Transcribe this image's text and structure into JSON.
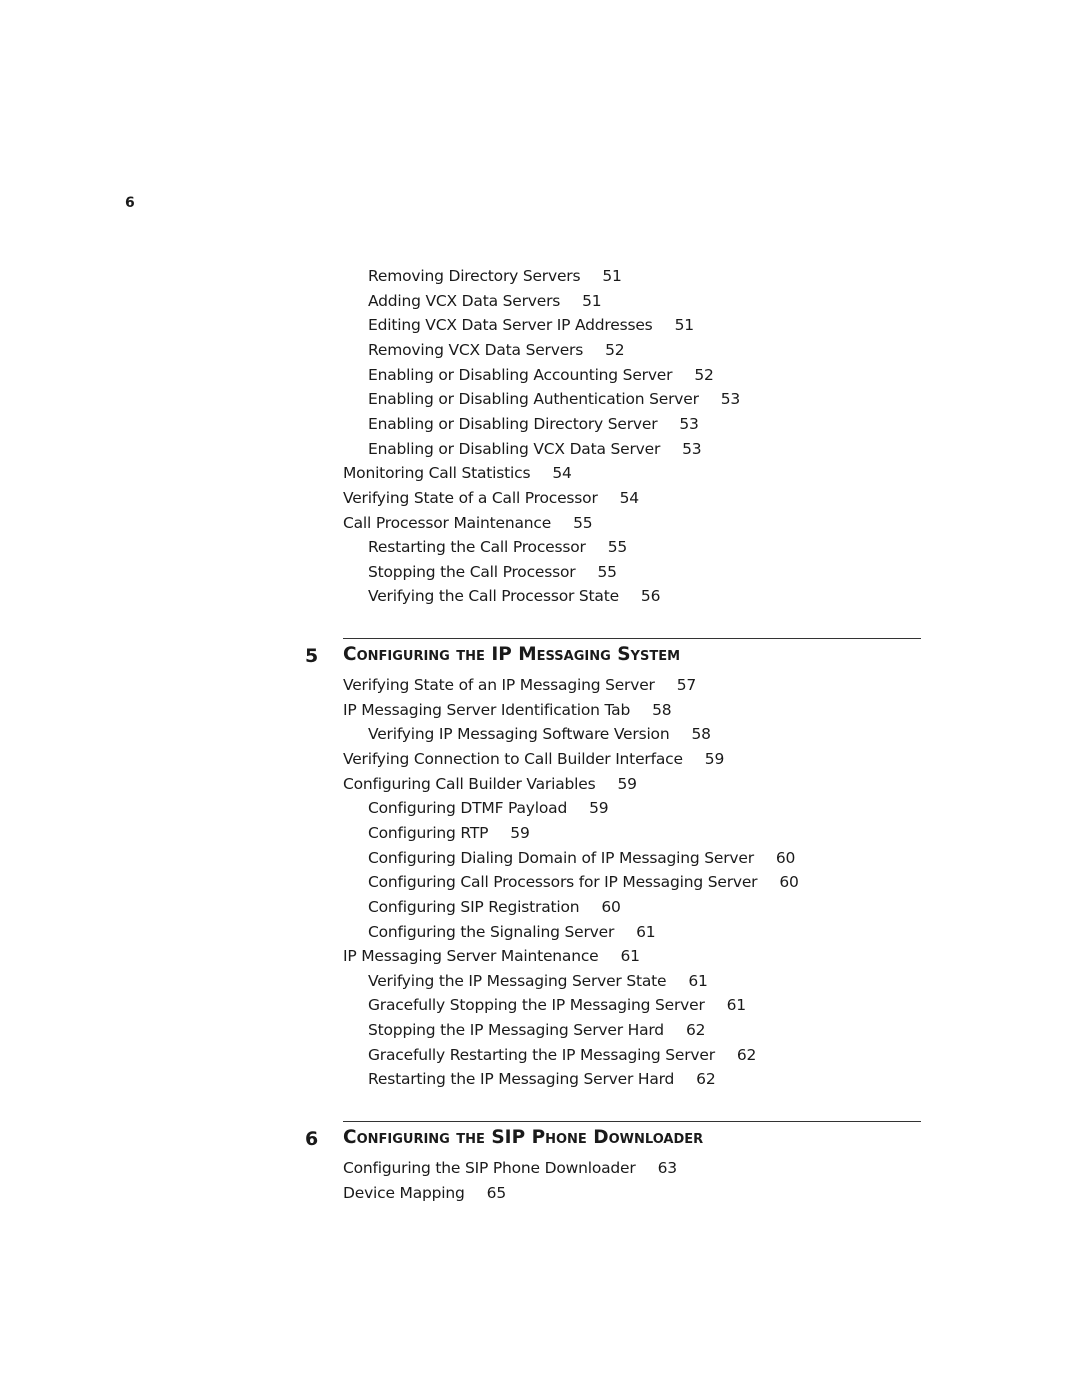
{
  "page_number": "6",
  "pre_entries": [
    {
      "level": 2,
      "title": "Removing Directory Servers",
      "page": "51"
    },
    {
      "level": 2,
      "title": "Adding VCX Data Servers",
      "page": "51"
    },
    {
      "level": 2,
      "title": "Editing VCX Data Server IP Addresses",
      "page": "51"
    },
    {
      "level": 2,
      "title": "Removing VCX Data Servers",
      "page": "52"
    },
    {
      "level": 2,
      "title": "Enabling or Disabling Accounting Server",
      "page": "52"
    },
    {
      "level": 2,
      "title": "Enabling or Disabling Authentication Server",
      "page": "53"
    },
    {
      "level": 2,
      "title": "Enabling or Disabling Directory Server",
      "page": "53"
    },
    {
      "level": 2,
      "title": "Enabling or Disabling VCX Data Server",
      "page": "53"
    },
    {
      "level": 1,
      "title": "Monitoring Call Statistics",
      "page": "54"
    },
    {
      "level": 1,
      "title": "Verifying State of a Call Processor",
      "page": "54"
    },
    {
      "level": 1,
      "title": "Call Processor Maintenance",
      "page": "55"
    },
    {
      "level": 2,
      "title": "Restarting the Call Processor",
      "page": "55"
    },
    {
      "level": 2,
      "title": "Stopping the Call Processor",
      "page": "55"
    },
    {
      "level": 2,
      "title": "Verifying the Call Processor State",
      "page": "56"
    }
  ],
  "chapters": [
    {
      "number": "5",
      "title": "Configuring the IP Messaging System",
      "entries": [
        {
          "level": 1,
          "title": "Verifying State of an IP Messaging Server",
          "page": "57"
        },
        {
          "level": 1,
          "title": "IP Messaging Server Identification Tab",
          "page": "58"
        },
        {
          "level": 2,
          "title": "Verifying IP Messaging Software Version",
          "page": "58"
        },
        {
          "level": 1,
          "title": "Verifying Connection to Call Builder Interface",
          "page": "59"
        },
        {
          "level": 1,
          "title": "Configuring Call Builder Variables",
          "page": "59"
        },
        {
          "level": 2,
          "title": "Configuring DTMF Payload",
          "page": "59"
        },
        {
          "level": 2,
          "title": "Configuring RTP",
          "page": "59"
        },
        {
          "level": 2,
          "title": "Configuring Dialing Domain of IP Messaging Server",
          "page": "60"
        },
        {
          "level": 2,
          "title": "Configuring Call Processors for IP Messaging Server",
          "page": "60"
        },
        {
          "level": 2,
          "title": "Configuring SIP Registration",
          "page": "60"
        },
        {
          "level": 2,
          "title": "Configuring the Signaling Server",
          "page": "61"
        },
        {
          "level": 1,
          "title": "IP Messaging Server Maintenance",
          "page": "61"
        },
        {
          "level": 2,
          "title": "Verifying the IP Messaging Server State",
          "page": "61"
        },
        {
          "level": 2,
          "title": "Gracefully Stopping the IP Messaging Server",
          "page": "61"
        },
        {
          "level": 2,
          "title": "Stopping the IP Messaging Server Hard",
          "page": "62"
        },
        {
          "level": 2,
          "title": "Gracefully Restarting the IP Messaging Server",
          "page": "62"
        },
        {
          "level": 2,
          "title": "Restarting the IP Messaging Server Hard",
          "page": "62"
        }
      ]
    },
    {
      "number": "6",
      "title": "Configuring the SIP Phone Downloader",
      "entries": [
        {
          "level": 1,
          "title": "Configuring the SIP Phone Downloader",
          "page": "63"
        },
        {
          "level": 1,
          "title": "Device Mapping",
          "page": "65"
        }
      ]
    }
  ]
}
